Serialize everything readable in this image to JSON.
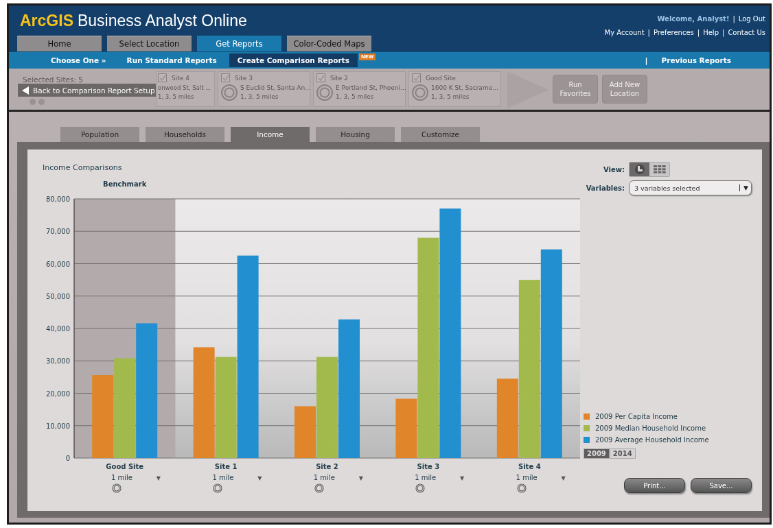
{
  "header": {
    "brand": "ArcGIS",
    "product": "Business Analyst Online",
    "welcome": "Welcome, Analyst!",
    "separator": "|",
    "logout": "Log Out",
    "links": [
      "My Account",
      "Preferences",
      "Help",
      "Contact Us"
    ]
  },
  "tabs": [
    {
      "label": "Home",
      "selected": false
    },
    {
      "label": "Select Location",
      "selected": false
    },
    {
      "label": "Get Reports",
      "selected": true
    },
    {
      "label": "Color-Coded Maps",
      "selected": false
    }
  ],
  "subnav": {
    "items": [
      {
        "label": "Choose One »",
        "selected": false
      },
      {
        "label": "Run Standard Reports",
        "selected": false
      },
      {
        "label": "Create Comparison Reports",
        "selected": true,
        "badge": "NEW"
      }
    ],
    "separator": "|",
    "right_link": "Previous Reports"
  },
  "site_strip": {
    "selected_sites": "Selected Sites: 5",
    "back_button": "Back to Comparison Report Setup",
    "sites": [
      {
        "name": "Site 4",
        "address": "onwood St, Salt ...",
        "radii": "1, 3, 5 miles",
        "checked": true,
        "partly_hidden": true
      },
      {
        "name": "Site 3",
        "address": "S Euclid St, Santa An...",
        "radii": "1, 3, 5 miles",
        "checked": true,
        "partly_hidden": false
      },
      {
        "name": "Site 2",
        "address": "E Portland St, Phoeni...",
        "radii": "1, 3, 5 miles",
        "checked": true,
        "partly_hidden": false
      },
      {
        "name": "Good Site",
        "address": "1600 K St, Sacrame...",
        "radii": "1, 3, 5 miles",
        "checked": true,
        "partly_hidden": false
      }
    ],
    "buttons": [
      "Run Favorites",
      "Add New Location"
    ]
  },
  "report_tabs": [
    {
      "label": "Population",
      "selected": false
    },
    {
      "label": "Households",
      "selected": false
    },
    {
      "label": "Income",
      "selected": true
    },
    {
      "label": "Housing",
      "selected": false
    },
    {
      "label": "Customize",
      "selected": false
    }
  ],
  "report": {
    "title": "Income Comparisons",
    "view": {
      "label": "View:",
      "options": [
        {
          "kind": "chart",
          "selected": true
        },
        {
          "kind": "table",
          "selected": false
        }
      ]
    },
    "variables": {
      "label": "Variables:",
      "value": "3 variables selected",
      "caret": "▼"
    },
    "chart_data": {
      "type": "bar",
      "categories": [
        "Good Site",
        "Site 1",
        "Site 2",
        "Site 3",
        "Site 4"
      ],
      "series": [
        {
          "name": "2009 Per Capita Income",
          "color": "#e0852a",
          "values": [
            25600,
            34200,
            16000,
            18300,
            24500
          ]
        },
        {
          "name": "2009 Median Household Income",
          "color": "#a2b94c",
          "values": [
            30800,
            31200,
            31200,
            68000,
            55000
          ]
        },
        {
          "name": "2009 Average Household Income",
          "color": "#2290d0",
          "values": [
            41600,
            62500,
            42800,
            77000,
            64400
          ]
        }
      ],
      "ylim": [
        0,
        80000
      ],
      "yticks": [
        {
          "value": 0,
          "label": "0"
        },
        {
          "value": 10000,
          "label": "10,000"
        },
        {
          "value": 20000,
          "label": "20,000"
        },
        {
          "value": 30000,
          "label": "30,000"
        },
        {
          "value": 40000,
          "label": "40,000"
        },
        {
          "value": 50000,
          "label": "50,000"
        },
        {
          "value": 60000,
          "label": "60,000"
        },
        {
          "value": 70000,
          "label": "70,000"
        },
        {
          "value": 80000,
          "label": "80,000"
        }
      ],
      "grid": true,
      "bands": [
        {
          "axis": "x",
          "from": "Good Site",
          "to": "Good Site",
          "label": "Benchmark"
        }
      ]
    },
    "site_controls": [
      {
        "radius": "1 mile",
        "caret": "▼"
      },
      {
        "radius": "1 mile",
        "caret": "▼"
      },
      {
        "radius": "1 mile",
        "caret": "▼"
      },
      {
        "radius": "1 mile",
        "caret": "▼"
      },
      {
        "radius": "1 mile",
        "caret": "▼"
      }
    ],
    "years": [
      {
        "label": "2009",
        "selected": true
      },
      {
        "label": "2014",
        "selected": false
      }
    ],
    "buttons": [
      "Print...",
      "Save..."
    ]
  }
}
